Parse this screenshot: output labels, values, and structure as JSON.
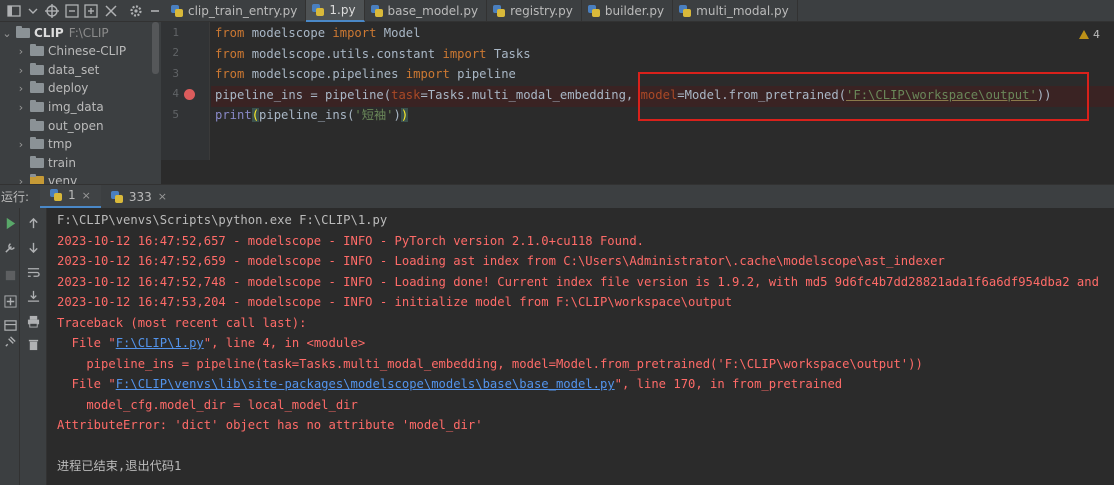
{
  "tabs": [
    {
      "label": "clip_train_entry.py",
      "active": false
    },
    {
      "label": "1.py",
      "active": true
    },
    {
      "label": "base_model.py",
      "active": false
    },
    {
      "label": "registry.py",
      "active": false
    },
    {
      "label": "builder.py",
      "active": false
    },
    {
      "label": "multi_modal.py",
      "active": false
    }
  ],
  "project": {
    "root_name": "CLIP",
    "root_path": "F:\\CLIP",
    "items": [
      {
        "label": "Chinese-CLIP",
        "expandable": true
      },
      {
        "label": "data_set",
        "expandable": true
      },
      {
        "label": "deploy",
        "expandable": true
      },
      {
        "label": "img_data",
        "expandable": true
      },
      {
        "label": "out_open",
        "expandable": false
      },
      {
        "label": "tmp",
        "expandable": true
      },
      {
        "label": "train",
        "expandable": false
      },
      {
        "label": "venv",
        "expandable": true
      }
    ]
  },
  "editor": {
    "line_numbers": [
      "1",
      "2",
      "3",
      "4",
      "5"
    ],
    "breakpoint_line": "4",
    "warning_count": "4",
    "lines": [
      {
        "kw1": "from",
        "mod": " modelscope ",
        "kw2": "import",
        "rest": " Model"
      },
      {
        "kw1": "from",
        "mod": " modelscope.utils.constant ",
        "kw2": "import",
        "rest": " Tasks"
      },
      {
        "kw1": "from",
        "mod": " modelscope.pipelines ",
        "kw2": "import",
        "rest": " pipeline"
      }
    ],
    "line4": {
      "a": "pipeline_ins = pipeline(",
      "p1": "task",
      "b": "=Tasks.multi_modal_embedding, ",
      "p2": "model",
      "c": "=Model.from_pretrained(",
      "s": "'F:\\CLIP\\workspace\\output'",
      "d": "))"
    },
    "line5": {
      "fn": "print",
      "open": "(",
      "a": "pipeline_ins(",
      "s": "'短袖'",
      "b": ")",
      "close": ")"
    }
  },
  "run": {
    "label": "运行:",
    "tabs": [
      {
        "label": "1",
        "active": true,
        "close": "×"
      },
      {
        "label": "333",
        "active": false,
        "close": "×"
      }
    ]
  },
  "console": {
    "cmd": "F:\\CLIP\\venvs\\Scripts\\python.exe F:\\CLIP\\1.py",
    "log1": "2023-10-12 16:47:52,657 - modelscope - INFO - PyTorch version 2.1.0+cu118 Found.",
    "log2": "2023-10-12 16:47:52,659 - modelscope - INFO - Loading ast index from C:\\Users\\Administrator\\.cache\\modelscope\\ast_indexer",
    "log3": "2023-10-12 16:47:52,748 - modelscope - INFO - Loading done! Current index file version is 1.9.2, with md5 9d6fc4b7dd28821ada1f6a6df954dba2 and",
    "log4": "2023-10-12 16:47:53,204 - modelscope - INFO - initialize model from F:\\CLIP\\workspace\\output",
    "tb_header": "Traceback (most recent call last):",
    "f1_pre": "  File \"",
    "f1_link": "F:\\CLIP\\1.py",
    "f1_post": "\", line 4, in <module>",
    "f1_code": "    pipeline_ins = pipeline(task=Tasks.multi_modal_embedding, model=Model.from_pretrained('F:\\CLIP\\workspace\\output'))",
    "f2_pre": "  File \"",
    "f2_link": "F:\\CLIP\\venvs\\lib\\site-packages\\modelscope\\models\\base\\base_model.py",
    "f2_post": "\", line 170, in from_pretrained",
    "f2_code": "    model_cfg.model_dir = local_model_dir",
    "error": "AttributeError: 'dict' object has no attribute 'model_dir'",
    "exit": "进程已结束,退出代码1"
  },
  "colors": {
    "bg": "#2b2b2b",
    "panel": "#3c3f41",
    "accent": "#4a88c7",
    "error": "#ff6b68",
    "highlight_box": "#d9211b"
  }
}
